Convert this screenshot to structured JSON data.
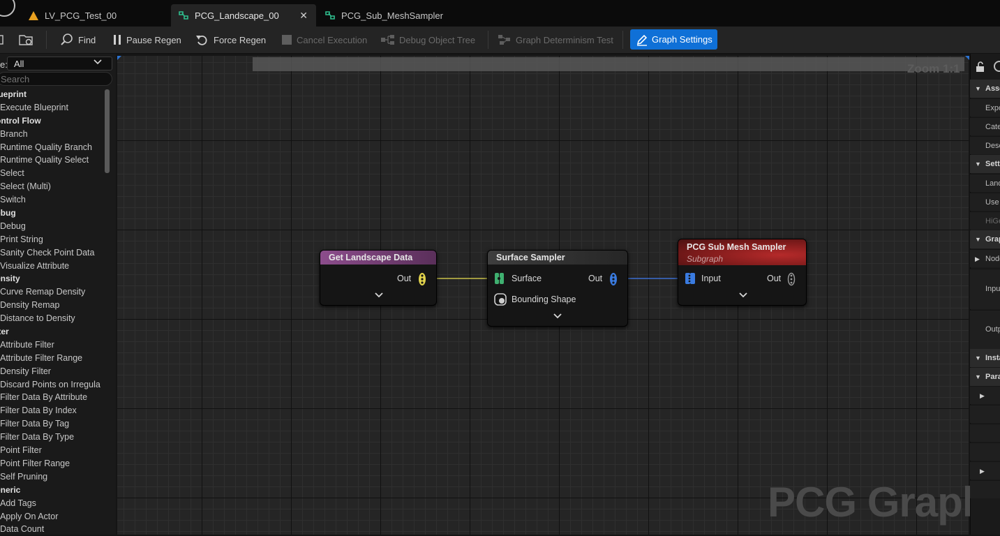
{
  "tabs": [
    {
      "label": "LV_PCG_Test_00",
      "active": false
    },
    {
      "label": "PCG_Landscape_00",
      "active": true
    },
    {
      "label": "PCG_Sub_MeshSampler",
      "active": false
    }
  ],
  "toolbar": {
    "find": "Find",
    "pause_regen": "Pause Regen",
    "force_regen": "Force Regen",
    "cancel_execution": "Cancel Execution",
    "debug_object_tree": "Debug Object Tree",
    "graph_determinism_test": "Graph Determinism Test",
    "graph_settings": "Graph Settings"
  },
  "palette": {
    "filter_label": "e:",
    "filter_value": "All",
    "search_placeholder": "Search",
    "items": [
      {
        "label": "lueprint",
        "category": true
      },
      {
        "label": "Execute Blueprint",
        "category": false
      },
      {
        "label": "ontrol Flow",
        "category": true
      },
      {
        "label": "Branch",
        "category": false
      },
      {
        "label": "Runtime Quality Branch",
        "category": false
      },
      {
        "label": "Runtime Quality Select",
        "category": false
      },
      {
        "label": "Select",
        "category": false
      },
      {
        "label": "Select (Multi)",
        "category": false
      },
      {
        "label": "Switch",
        "category": false
      },
      {
        "label": "ebug",
        "category": true
      },
      {
        "label": "Debug",
        "category": false
      },
      {
        "label": "Print String",
        "category": false
      },
      {
        "label": "Sanity Check Point Data",
        "category": false
      },
      {
        "label": "Visualize Attribute",
        "category": false
      },
      {
        "label": "ensity",
        "category": true
      },
      {
        "label": "Curve Remap Density",
        "category": false
      },
      {
        "label": "Density Remap",
        "category": false
      },
      {
        "label": "Distance to Density",
        "category": false
      },
      {
        "label": "lter",
        "category": true
      },
      {
        "label": "Attribute Filter",
        "category": false
      },
      {
        "label": "Attribute Filter Range",
        "category": false
      },
      {
        "label": "Density Filter",
        "category": false
      },
      {
        "label": "Discard Points on Irregula",
        "category": false
      },
      {
        "label": "Filter Data By Attribute",
        "category": false
      },
      {
        "label": "Filter Data By Index",
        "category": false
      },
      {
        "label": "Filter Data By Tag",
        "category": false
      },
      {
        "label": "Filter Data By Type",
        "category": false
      },
      {
        "label": "Point Filter",
        "category": false
      },
      {
        "label": "Point Filter Range",
        "category": false
      },
      {
        "label": "Self Pruning",
        "category": false
      },
      {
        "label": "eneric",
        "category": true
      },
      {
        "label": "Add Tags",
        "category": false
      },
      {
        "label": "Apply On Actor",
        "category": false
      },
      {
        "label": "Data Count",
        "category": false
      }
    ]
  },
  "canvas": {
    "zoom": "Zoom 1:1",
    "watermark": "PCG Graph"
  },
  "nodes": {
    "get_landscape": {
      "title": "Get Landscape Data",
      "out": "Out",
      "color": "#8c4d8c"
    },
    "surface_sampler": {
      "title": "Surface Sampler",
      "in1": "Surface",
      "in2": "Bounding Shape",
      "out": "Out",
      "color": "#3a3a3a"
    },
    "sub_mesh": {
      "title": "PCG Sub Mesh Sampler",
      "subtitle": "Subgraph",
      "in": "Input",
      "out": "Out",
      "color": "#8e2020"
    }
  },
  "details": {
    "rows": [
      {
        "label": "Asse",
        "type": "section"
      },
      {
        "label": "Expo",
        "type": "prop"
      },
      {
        "label": "Cate",
        "type": "prop"
      },
      {
        "label": "Desc",
        "type": "prop"
      },
      {
        "label": "Setti",
        "type": "section"
      },
      {
        "label": "Land",
        "type": "prop"
      },
      {
        "label": "Use",
        "type": "prop"
      },
      {
        "label": "HiGe",
        "type": "prop"
      },
      {
        "label": "Grap",
        "type": "section"
      },
      {
        "label": "Node",
        "type": "prop"
      },
      {
        "label": "Inpu",
        "type": "prop"
      },
      {
        "label": "Outp",
        "type": "prop"
      },
      {
        "label": "Insta",
        "type": "section"
      },
      {
        "label": "Para",
        "type": "section"
      }
    ]
  },
  "colors": {
    "accent": "#0f70d7",
    "pin_point": "#e2d34c",
    "pin_surface": "#3fb070",
    "pin_sampler_out": "#3a7be0",
    "wire_yellow": "#c9c24a",
    "wire_blue": "#3c6fd0"
  }
}
